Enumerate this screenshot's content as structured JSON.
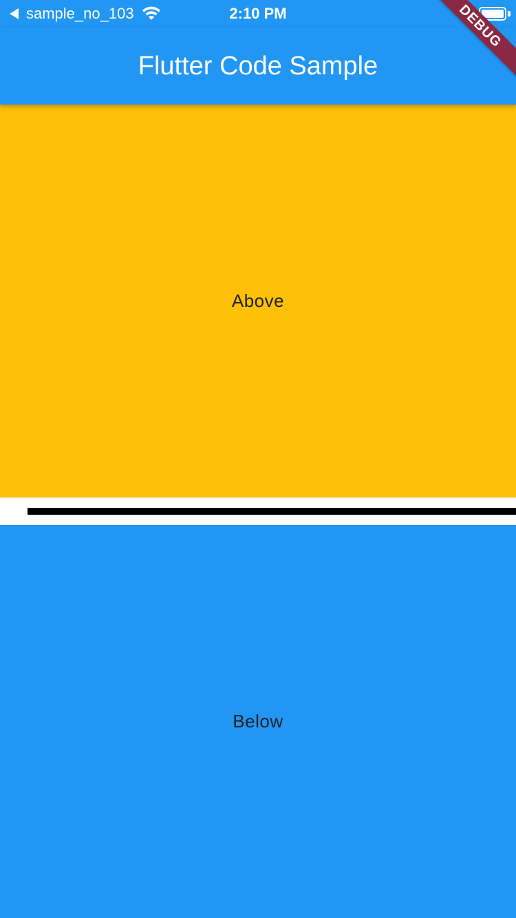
{
  "status_bar": {
    "carrier": "sample_no_103",
    "time": "2:10 PM",
    "back_icon": "back-arrow-icon",
    "wifi_icon": "wifi-icon",
    "battery_icon": "battery-icon",
    "battery_level": 1.0
  },
  "app_bar": {
    "title": "Flutter Code Sample",
    "color": "#2196f3"
  },
  "debug_banner": {
    "label": "DEBUG",
    "color": "#8b2942"
  },
  "panels": {
    "above": {
      "label": "Above",
      "color": "#ffc107"
    },
    "below": {
      "label": "Below",
      "color": "#2196f3"
    }
  },
  "divider": {
    "color": "#000000"
  }
}
